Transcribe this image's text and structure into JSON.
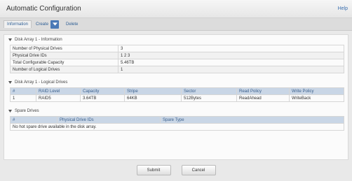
{
  "header": {
    "title": "Automatic Configuration",
    "help_label": "Help"
  },
  "tabs": {
    "information": "Information",
    "create": "Create",
    "delete": "Delete"
  },
  "info_section": {
    "title": "Disk Array 1 - Information",
    "rows": [
      {
        "label": "Number of Physical Drives",
        "value": "3"
      },
      {
        "label": "Physical Drive IDs",
        "value": "1 2 3"
      },
      {
        "label": "Total Configurable Capacity",
        "value": "5.46TB"
      },
      {
        "label": "Number of Logical Drives",
        "value": "1"
      }
    ]
  },
  "logical_section": {
    "title": "Disk Array 1 - Logical Drives",
    "columns": [
      "#",
      "RAID Level",
      "Capacity",
      "Stripe",
      "Sector",
      "Read Policy",
      "Write Policy"
    ],
    "rows": [
      [
        "1",
        "RAID5",
        "3.64TB",
        "64KB",
        "512Bytes",
        "ReadAhead",
        "WriteBack"
      ]
    ]
  },
  "spare_section": {
    "title": "Spare Drives",
    "columns": [
      "#",
      "Physical Drive IDs",
      "Spare Type"
    ],
    "empty_message": "No hot spare drive available in the disk array."
  },
  "buttons": {
    "submit": "Submit",
    "cancel": "Cancel"
  },
  "colors": {
    "accent": "#3a6fb0",
    "header_row": "#c9d6e6",
    "dropdown_button": "#4a79b6"
  }
}
